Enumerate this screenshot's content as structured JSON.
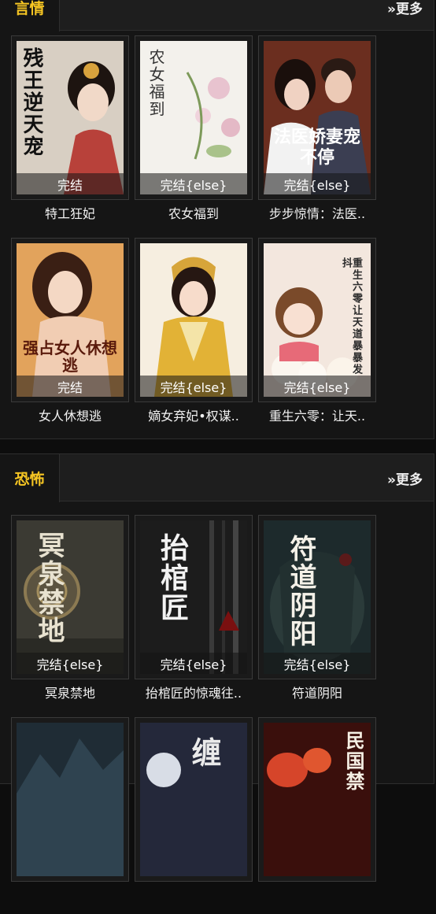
{
  "sections": [
    {
      "title": "言情",
      "more": "»更多",
      "books": [
        {
          "name": "特工狂妃",
          "status": "完结",
          "cover_text": "残王逆天宠",
          "bg": "#d8cfc3"
        },
        {
          "name": "农女福到",
          "status": "完结{else}",
          "cover_text": "农女福到",
          "bg": "#f3f1ec"
        },
        {
          "name": "步步惊情：法医..",
          "status": "完结{else}",
          "cover_text": "法医娇妻宠不停",
          "bg": "#6b2e1f"
        },
        {
          "name": "女人休想逃",
          "status": "完结",
          "cover_text": "强占女人休想逃",
          "bg": "#e2a35c"
        },
        {
          "name": "嫡女弃妃•权谋..",
          "status": "完结{else}",
          "cover_text": "",
          "bg": "#f6eee0"
        },
        {
          "name": "重生六零：让天..",
          "status": "完结{else}",
          "cover_text": "重生六零让天道暴暴发抖",
          "bg": "#f3e7de"
        }
      ]
    },
    {
      "title": "恐怖",
      "more": "»更多",
      "books": [
        {
          "name": "冥泉禁地",
          "status": "完结{else}",
          "cover_text": "冥泉禁地",
          "bg": "#3b3a33"
        },
        {
          "name": "抬棺匠的惊魂往..",
          "status": "完结{else}",
          "cover_text": "抬棺匠",
          "bg": "#1c1c1c"
        },
        {
          "name": "符道阴阳",
          "status": "完结{else}",
          "cover_text": "符道阴阳",
          "bg": "#1d2a2c"
        },
        {
          "name": "",
          "status": "",
          "cover_text": "",
          "bg": "#1f2c35"
        },
        {
          "name": "",
          "status": "",
          "cover_text": "缠",
          "bg": "#24283a"
        },
        {
          "name": "",
          "status": "",
          "cover_text": "民国禁",
          "bg": "#3a0f0c"
        }
      ]
    }
  ],
  "colors": {
    "accent": "#f7c623",
    "panel": "#151515",
    "header": "#1e1e1e"
  }
}
